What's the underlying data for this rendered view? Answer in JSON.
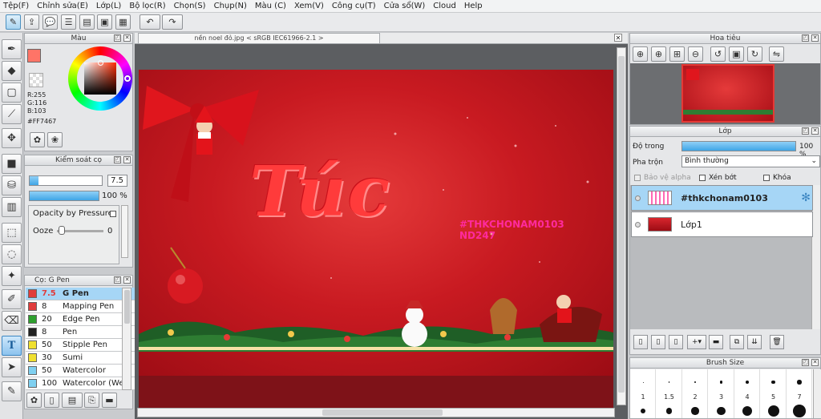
{
  "menu": [
    "Tệp(F)",
    "Chỉnh sửa(E)",
    "Lớp(L)",
    "Bộ lọc(R)",
    "Chọn(S)",
    "Chụp(N)",
    "Màu (C)",
    "Xem(V)",
    "Công cụ(T)",
    "Cửa sổ(W)",
    "Cloud",
    "Help"
  ],
  "color_panel": {
    "title": "Màu",
    "r": "R:255",
    "g": "G:116",
    "b": "B:103",
    "hex": "#FF7467",
    "main_color": "#FF7467"
  },
  "tool_control": {
    "title": "Kiểm soát cọ",
    "size_value": "7.5",
    "opacity_value": "100 %",
    "opacity_pressure_label": "Opacity by Pressure",
    "ooze_label": "Ooze",
    "ooze_value": "0"
  },
  "brush_panel": {
    "title": "Cọ: G Pen",
    "items": [
      {
        "size": "7.5",
        "name": "G Pen",
        "color": "#e03c3c"
      },
      {
        "size": "8",
        "name": "Mapping Pen",
        "color": "#e03c3c"
      },
      {
        "size": "20",
        "name": "Edge Pen",
        "color": "#2ea02e"
      },
      {
        "size": "8",
        "name": "Pen",
        "color": "#222222"
      },
      {
        "size": "50",
        "name": "Stipple Pen",
        "color": "#f0e030"
      },
      {
        "size": "30",
        "name": "Sumi",
        "color": "#f0e030"
      },
      {
        "size": "50",
        "name": "Watercolor",
        "color": "#7fd0f0"
      },
      {
        "size": "100",
        "name": "Watercolor (Wet)",
        "color": "#7fd0f0"
      }
    ]
  },
  "canvas": {
    "tab_title": "nền noel đỏ.jpg < sRGB IEC61966-2.1 >",
    "title_text": "Túc",
    "tag_text": "#THKCHONAM0103",
    "tag_text2": "ND247"
  },
  "navigator": {
    "title": "Hoa tiêu"
  },
  "layer_panel": {
    "title": "Lớp",
    "opacity_label": "Độ trong",
    "opacity_value": "100 %",
    "opacity_fraction": 1.0,
    "blend_label": "Pha trộn",
    "blend_value": "Bình thường",
    "protect_alpha": "Bảo vệ alpha",
    "clip": "Xén bớt",
    "lock": "Khóa",
    "layers": [
      {
        "name": "#thkchonam0103"
      },
      {
        "name": "Lớp1"
      }
    ]
  },
  "brush_size_panel": {
    "title": "Brush Size",
    "sizes": [
      "1",
      "1.5",
      "2",
      "3",
      "4",
      "5",
      "7"
    ]
  }
}
